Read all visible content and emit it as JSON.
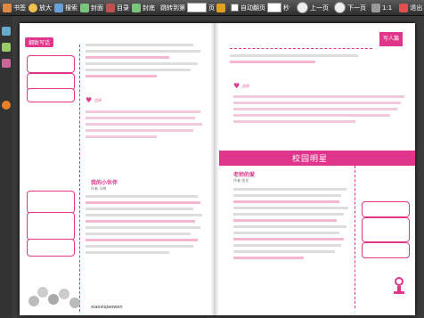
{
  "toolbar": {
    "items": [
      {
        "label": "书签"
      },
      {
        "label": "放大"
      },
      {
        "label": "搜索"
      },
      {
        "label": "封面"
      },
      {
        "label": "目录"
      },
      {
        "label": "封底"
      }
    ],
    "jump_label": "跳转到第",
    "jump_suffix": "页",
    "auto_label": "自动翻页",
    "seconds_suffix": "秒",
    "prev_label": "上一页",
    "next_label": "下一页",
    "ratio": "1:1",
    "exit_label": "退出"
  },
  "book": {
    "left_tag": "细致写话",
    "right_tag": "写人篇",
    "banner_title": "校园明星",
    "left_story_title": "我的小伙伴",
    "left_author": "作者 马晓",
    "right_story_title": "老师的爱",
    "right_author": "作者 张艺",
    "left_review_label": "点评",
    "right_review_label": "点评",
    "brand": "xiaosiqiaowen"
  },
  "colors": {
    "accent": "#e0358b",
    "highlight": "#f6b6d3"
  }
}
